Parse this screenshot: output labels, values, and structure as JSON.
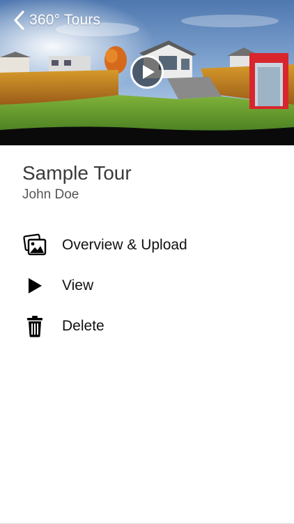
{
  "nav": {
    "back_label": "360° Tours"
  },
  "tour": {
    "title": "Sample Tour",
    "owner": "John Doe"
  },
  "menu": [
    {
      "label": "Overview & Upload",
      "icon": "photos-icon"
    },
    {
      "label": "View",
      "icon": "play-icon"
    },
    {
      "label": "Delete",
      "icon": "trash-icon"
    }
  ],
  "colors": {
    "nav_text": "#ffffff",
    "accent_gate": "#d8262c"
  }
}
